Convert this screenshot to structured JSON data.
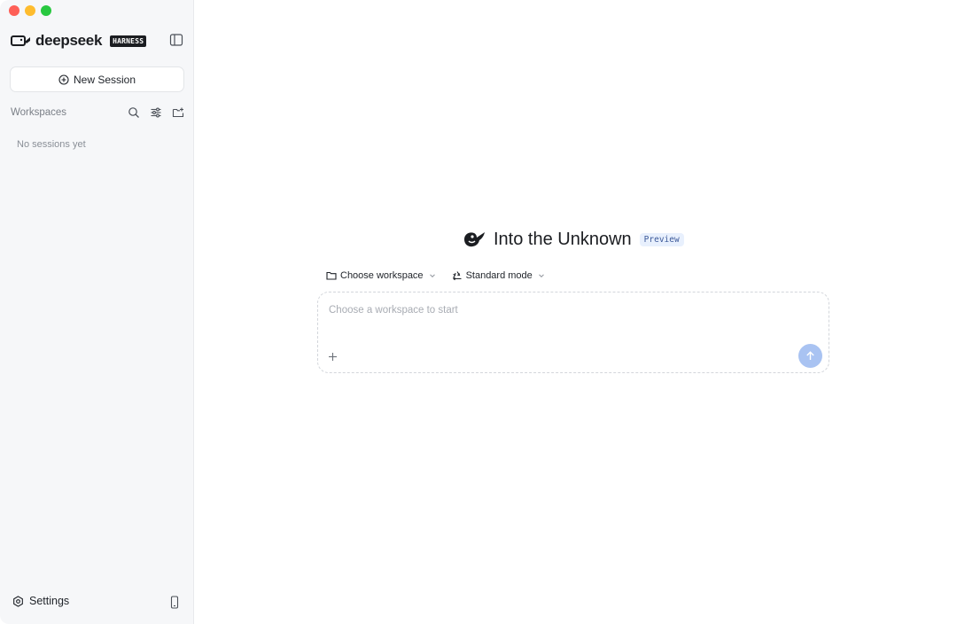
{
  "window": {
    "controls": [
      "close",
      "minimize",
      "maximize"
    ]
  },
  "sidebar": {
    "brand": {
      "name": "deepseek",
      "badge": "HARNESS",
      "logo_icon": "whale-logo-icon"
    },
    "toggle_icon": "sidebar-toggle-icon",
    "new_session": {
      "label": "New Session",
      "icon": "plus-circle-icon"
    },
    "workspaces": {
      "label": "Workspaces",
      "tools": [
        "search-icon",
        "filter-sliders-icon",
        "new-folder-icon"
      ]
    },
    "empty_text": "No sessions yet",
    "footer": {
      "settings_label": "Settings",
      "settings_icon": "gear-icon",
      "device_icon": "phone-icon"
    }
  },
  "main": {
    "hero": {
      "title": "Into the Unknown",
      "badge": "Preview",
      "logo_icon": "whale-logo-icon"
    },
    "selectors": {
      "workspace_label": "Choose workspace",
      "workspace_icon": "folder-icon",
      "mode_label": "Standard mode",
      "mode_icon": "recycle-icon"
    },
    "composer": {
      "placeholder": "Choose a workspace to start",
      "value": "",
      "attach_icon": "plus-icon",
      "send_icon": "arrow-up-icon"
    }
  },
  "colors": {
    "sidebar_bg": "#f6f7f9",
    "accent_send": "#a9c3f2",
    "badge_bg": "#e8f0fd",
    "badge_text": "#3d5a9a"
  }
}
